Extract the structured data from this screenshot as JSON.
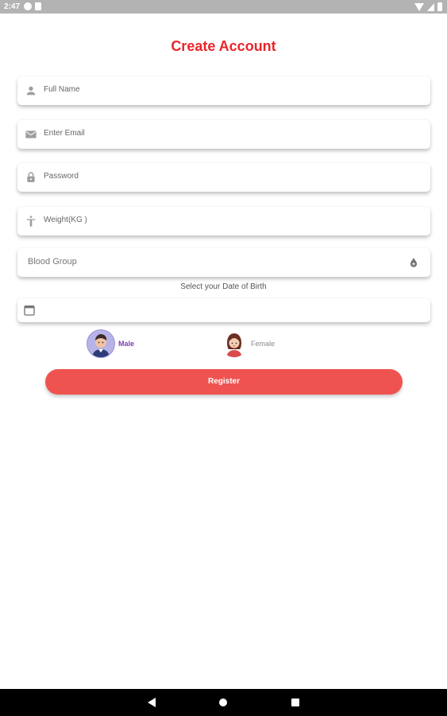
{
  "status_bar": {
    "time": "2:47",
    "icons": [
      "app-notification-icon",
      "sd-card-icon",
      "wifi-icon",
      "signal-icon",
      "battery-icon"
    ]
  },
  "title": "Create Account",
  "fields": {
    "full_name": {
      "placeholder": "Full Name",
      "icon": "person-icon"
    },
    "email": {
      "placeholder": "Enter Email",
      "icon": "mail-icon"
    },
    "password": {
      "placeholder": "Password",
      "icon": "lock-icon"
    },
    "weight": {
      "placeholder": "Weight(KG )",
      "icon": "accessibility-icon"
    },
    "blood_group": {
      "placeholder": "Blood Group",
      "icon": "blood-drop-icon"
    }
  },
  "dob": {
    "label": "Select your Date of Birth",
    "value": "",
    "icon": "calendar-icon"
  },
  "gender": {
    "male_label": "Male",
    "female_label": "Female",
    "selected": "Male"
  },
  "register_label": "Register",
  "colors": {
    "title": "#e8252b",
    "register_button": "#ef5350",
    "male_selected": "#7b3fb0",
    "status_bar": "#b3b3b3",
    "nav_bar": "#000000"
  }
}
